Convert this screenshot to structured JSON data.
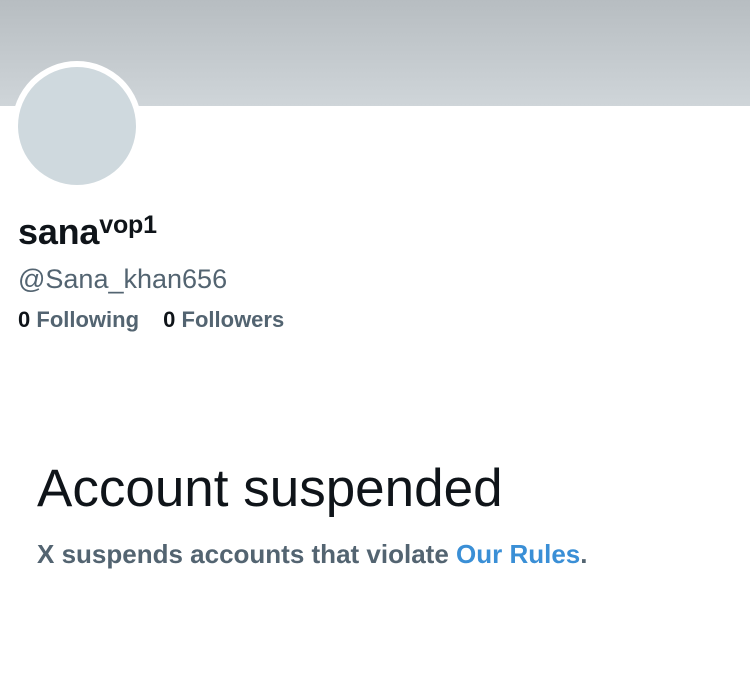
{
  "profile": {
    "display_name": "sana",
    "display_name_superscript": "vop1",
    "handle": "@Sana_khan656",
    "following_count": "0",
    "following_label": "Following",
    "followers_count": "0",
    "followers_label": "Followers"
  },
  "suspension": {
    "title": "Account suspended",
    "note_prefix": "X suspends accounts that violate ",
    "rules_link": "Our Rules",
    "note_suffix": "."
  },
  "colors": {
    "banner": "#c3c9cd",
    "avatar": "#cfd9de",
    "secondary_text": "#536471",
    "link": "#3a8fd6"
  }
}
